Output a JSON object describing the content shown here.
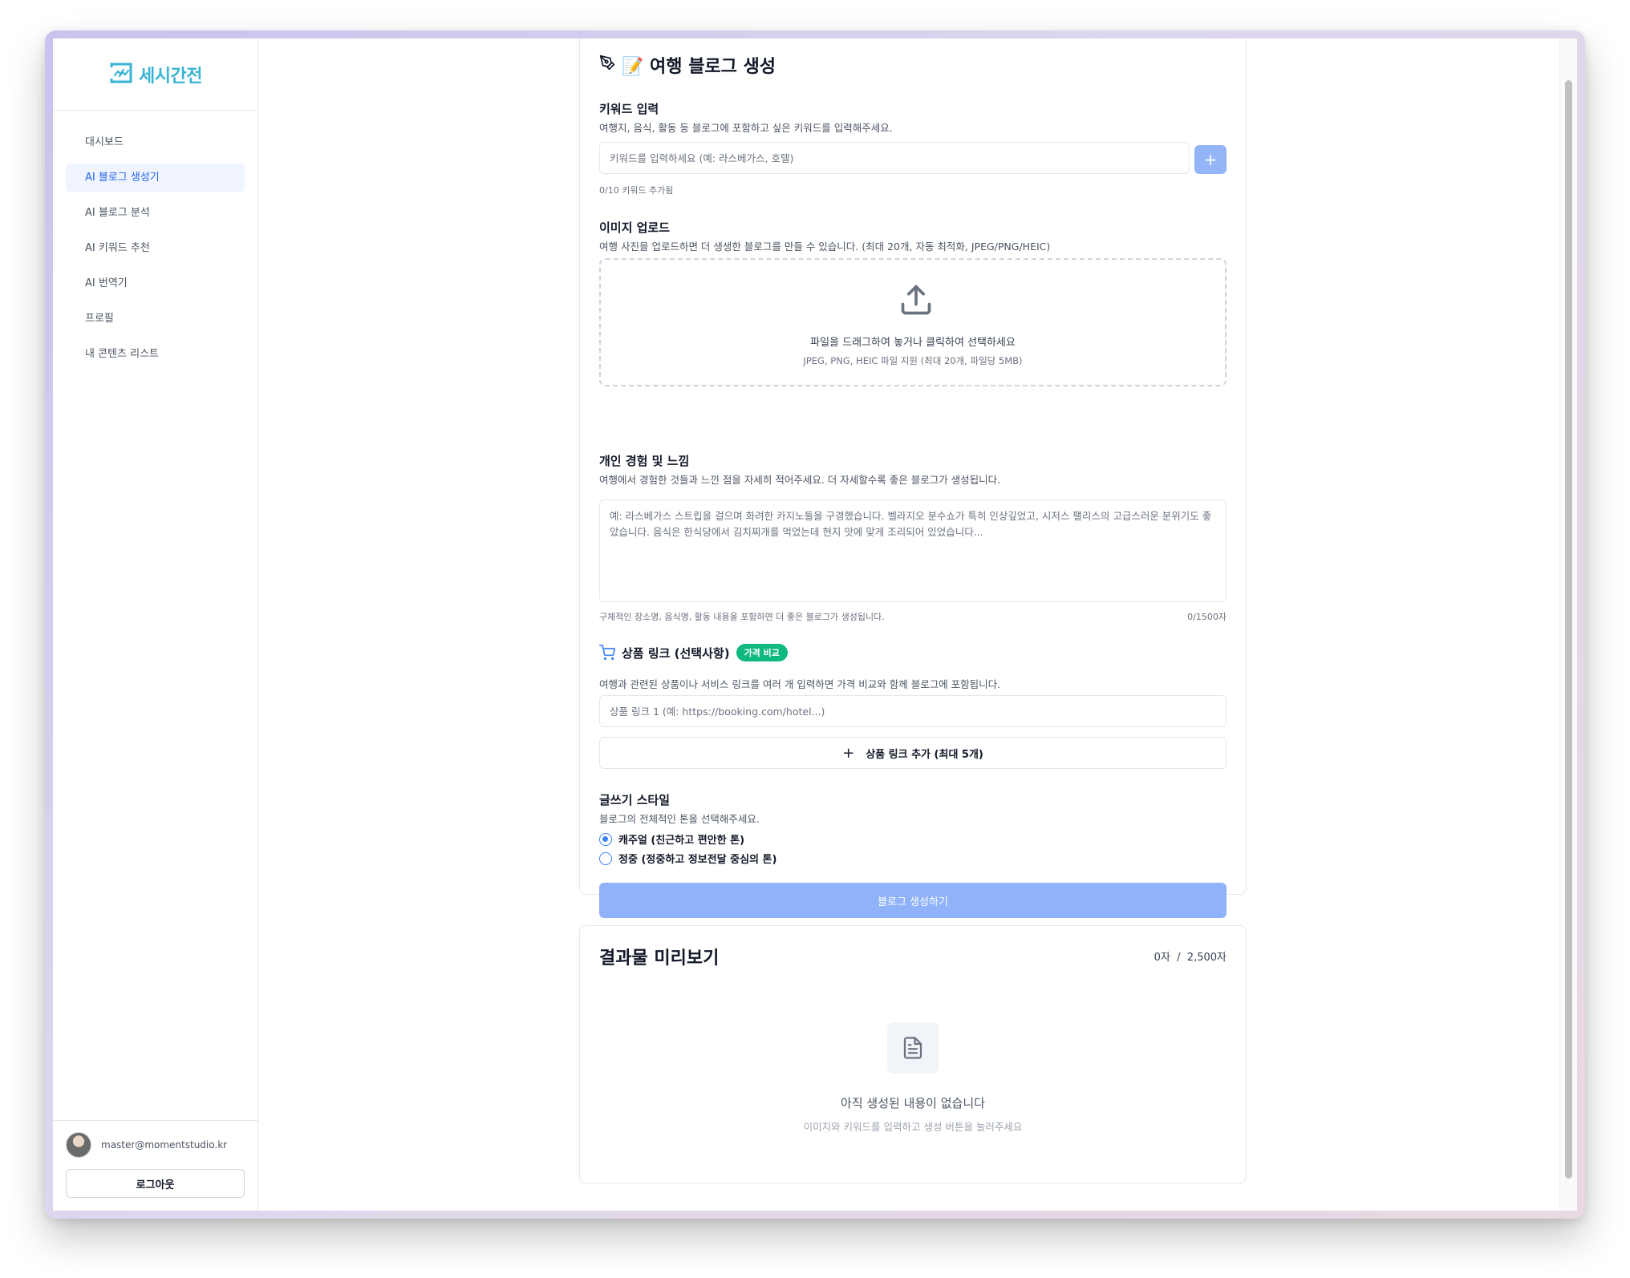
{
  "app": {
    "logo_text": "세시간전"
  },
  "sidebar": {
    "items": [
      {
        "label": "대시보드"
      },
      {
        "label": "AI 블로그 생성기"
      },
      {
        "label": "AI 블로그 분석"
      },
      {
        "label": "AI 키워드 추천"
      },
      {
        "label": "AI 번역기"
      },
      {
        "label": "프로필"
      },
      {
        "label": "내 콘텐츠 리스트"
      }
    ],
    "active_index": 1,
    "user_email": "master@momentstudio.kr",
    "logout_label": "로그아웃"
  },
  "form": {
    "title": "📝 여행 블로그 생성",
    "keyword": {
      "title": "키워드 입력",
      "desc": "여행지, 음식, 활동 등 블로그에 포함하고 싶은 키워드를 입력해주세요.",
      "placeholder": "키워드를 입력하세요 (예: 라스베가스, 호텔)",
      "add_label": "+",
      "count_hint": "0/10 키워드 추가됨"
    },
    "image": {
      "title": "이미지 업로드",
      "desc": "여행 사진을 업로드하면 더 생생한 블로그를 만들 수 있습니다. (최대 20개, 자동 최적화, JPEG/PNG/HEIC)",
      "drop_main": "파일을 드래그하여 놓거나 클릭하여 선택하세요",
      "drop_sub": "JPEG, PNG, HEIC 파일 지원 (최대 20개, 파일당 5MB)"
    },
    "experience": {
      "title": "개인 경험 및 느낌",
      "desc": "여행에서 경험한 것들과 느낀 점을 자세히 적어주세요. 더 자세할수록 좋은 블로그가 생성됩니다.",
      "placeholder": "예: 라스베가스 스트립을 걸으며 화려한 카지노들을 구경했습니다. 벨라지오 분수쇼가 특히 인상깊었고, 시저스 팰리스의 고급스러운 분위기도 좋았습니다. 음식은 한식당에서 김치찌개를 먹었는데 현지 맛에 맞게 조리되어 있었습니다...",
      "hint": "구체적인 장소명, 음식명, 활동 내용을 포함하면 더 좋은 블로그가 생성됩니다.",
      "char_count": "0/1500자"
    },
    "product": {
      "title": "상품 링크 (선택사항)",
      "badge": "가격 비교",
      "desc": "여행과 관련된 상품이나 서비스 링크를 여러 개 입력하면 가격 비교와 함께 블로그에 포함됩니다.",
      "placeholder": "상품 링크 1 (예: https://booking.com/hotel...)",
      "add_label": "상품 링크 추가 (최대 5개)"
    },
    "style": {
      "title": "글쓰기 스타일",
      "desc": "블로그의 전체적인 톤을 선택해주세요.",
      "options": [
        {
          "label": "캐주얼 (친근하고 편안한 톤)",
          "checked": true
        },
        {
          "label": "정중 (정중하고 정보전달 중심의 톤)",
          "checked": false
        }
      ]
    },
    "generate_label": "블로그 생성하기"
  },
  "preview": {
    "title": "결과물 미리보기",
    "count": "0자  /  2,500자",
    "empty_title": "아직 생성된 내용이 없습니다",
    "empty_sub": "이미지와 키워드를 입력하고 생성 버튼을 눌러주세요"
  },
  "colors": {
    "accent": "#2563eb",
    "logo": "#37b3d4",
    "button_disabled": "#8fb2f8",
    "badge": "#10b981"
  }
}
